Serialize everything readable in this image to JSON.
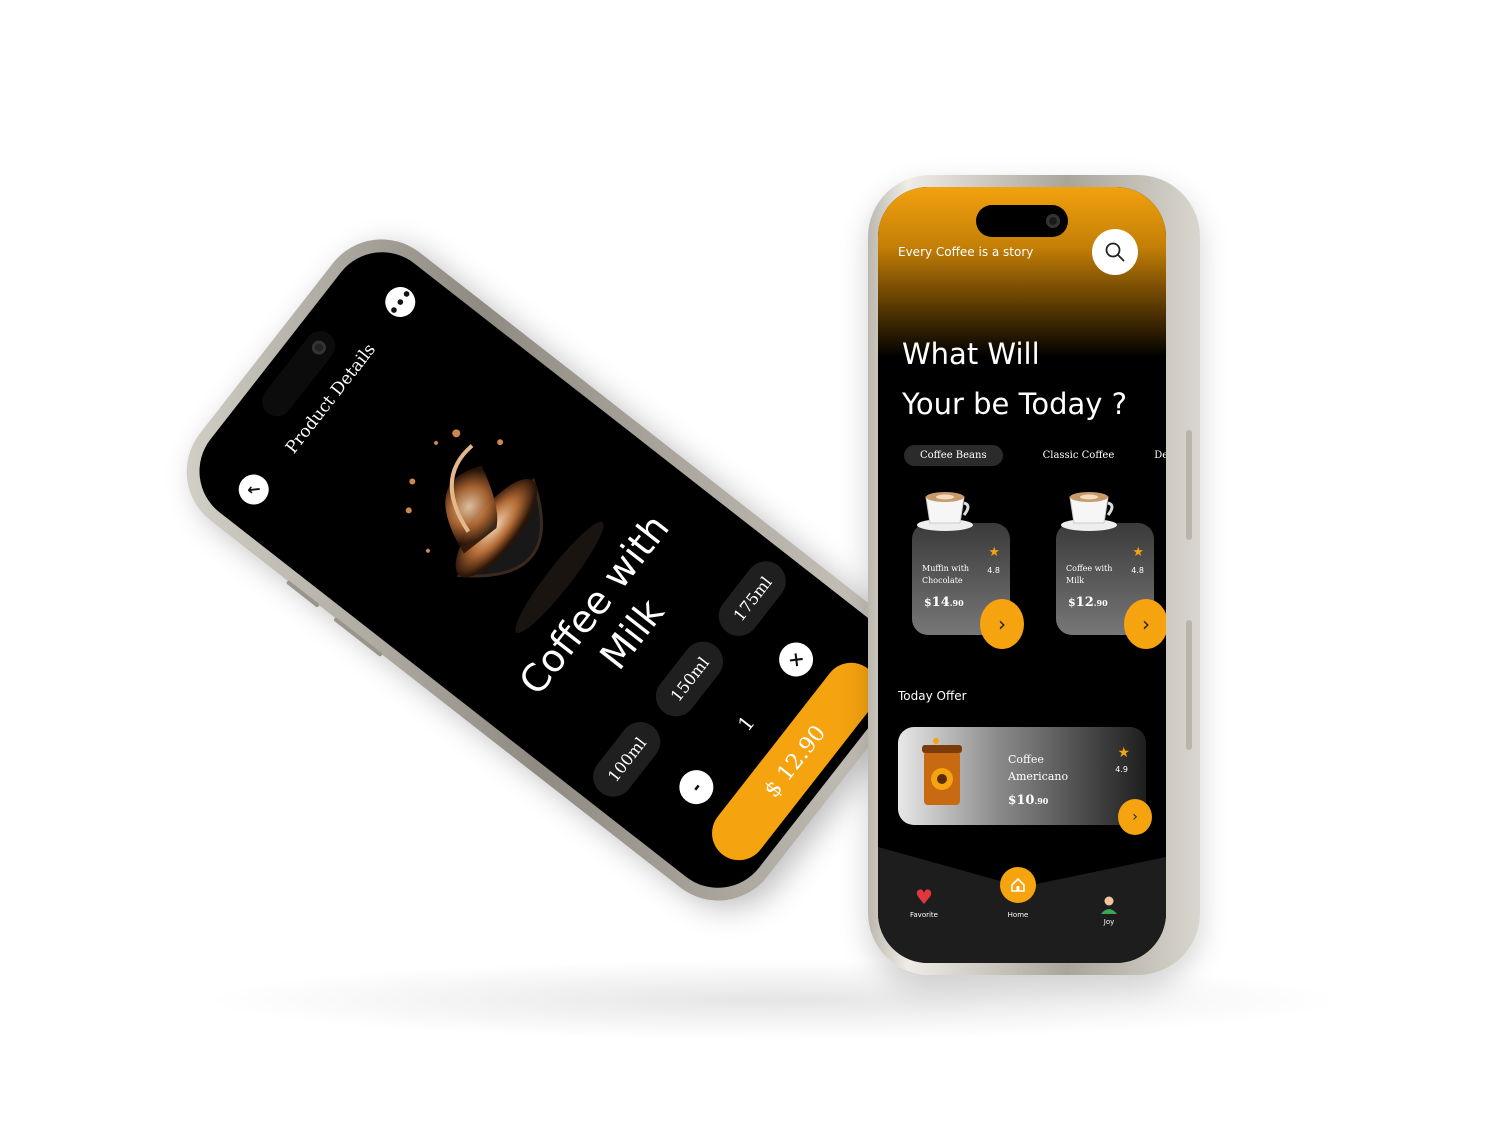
{
  "detail_screen": {
    "title": "Product Details",
    "back_icon": "arrow-up-left-icon",
    "more_icon": "more-dots-icon",
    "product_name_line1": "Coffee with",
    "product_name_line2": "Milk",
    "sizes": [
      "100ml",
      "150ml",
      "175ml"
    ],
    "quantity": "1",
    "decrement_label": "-",
    "increment_label": "×",
    "price_label": "$ 12.90"
  },
  "home_screen": {
    "tagline": "Every Coffee is a story",
    "headline_line1": "What Will",
    "headline_line2": "Your be Today ?",
    "tabs": [
      "Coffee Beans",
      "Classic Coffee",
      "Dessert Co"
    ],
    "products": [
      {
        "name": "Muffin with Chocolate",
        "rating": "4.8",
        "price_symbol": "$",
        "price_main": "14",
        "price_cents": ".90"
      },
      {
        "name": "Coffee with Milk",
        "rating": "4.8",
        "price_symbol": "$",
        "price_main": "12",
        "price_cents": ".90"
      }
    ],
    "offer_section_title": "Today Offer",
    "offer": {
      "name_line1": "Coffee",
      "name_line2": "Americano",
      "rating": "4.9",
      "price_symbol": "$",
      "price_main": "10",
      "price_cents": ".90"
    },
    "nav": [
      {
        "label": "Favorite",
        "icon": "heart-icon"
      },
      {
        "label": "Home",
        "icon": "home-icon"
      },
      {
        "label": "Joy",
        "icon": "user-icon"
      }
    ]
  },
  "colors": {
    "accent": "#f6a310",
    "background": "#000000"
  }
}
